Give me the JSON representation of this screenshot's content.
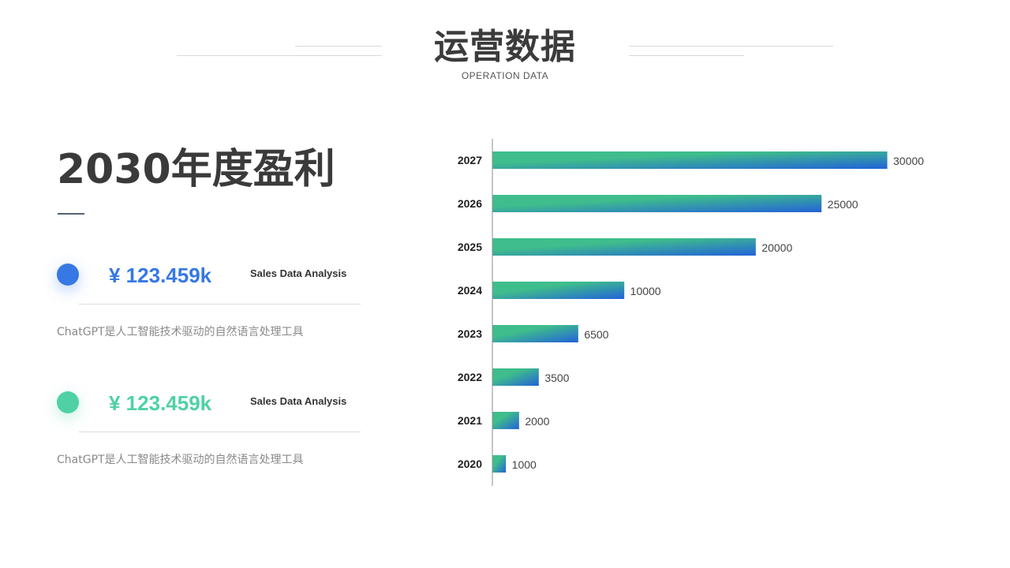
{
  "header": {
    "title": "运营数据",
    "subtitle": "OPERATION DATA"
  },
  "left": {
    "heading": "2030年度盈利",
    "stats": [
      {
        "value": "¥ 123.459k",
        "caption": "Sales Data Analysis",
        "description": "ChatGPT是人工智能技术驱动的自然语言处理工具",
        "color": "#3678e4"
      },
      {
        "value": "¥ 123.459k",
        "caption": "Sales Data Analysis",
        "description": "ChatGPT是人工智能技术驱动的自然语言处理工具",
        "color": "#4fd1a5"
      }
    ]
  },
  "colors": {
    "gradient_start": "#3fbd8c",
    "gradient_end": "#2262d8",
    "axis": "#8c8c8c",
    "label_text": "#1f1f1f",
    "value_text": "#444444"
  },
  "chart_data": {
    "type": "bar",
    "orientation": "horizontal",
    "categories": [
      "2027",
      "2026",
      "2025",
      "2024",
      "2023",
      "2022",
      "2021",
      "2020"
    ],
    "values": [
      30000,
      25000,
      20000,
      10000,
      6500,
      3500,
      2000,
      1000
    ],
    "title": "",
    "xlabel": "",
    "ylabel": "",
    "xlim": [
      0,
      30000
    ],
    "grid": false,
    "data_labels": [
      "30000",
      "25000",
      "20000",
      "10000",
      "6500",
      "3500",
      "2000",
      "1000"
    ]
  }
}
